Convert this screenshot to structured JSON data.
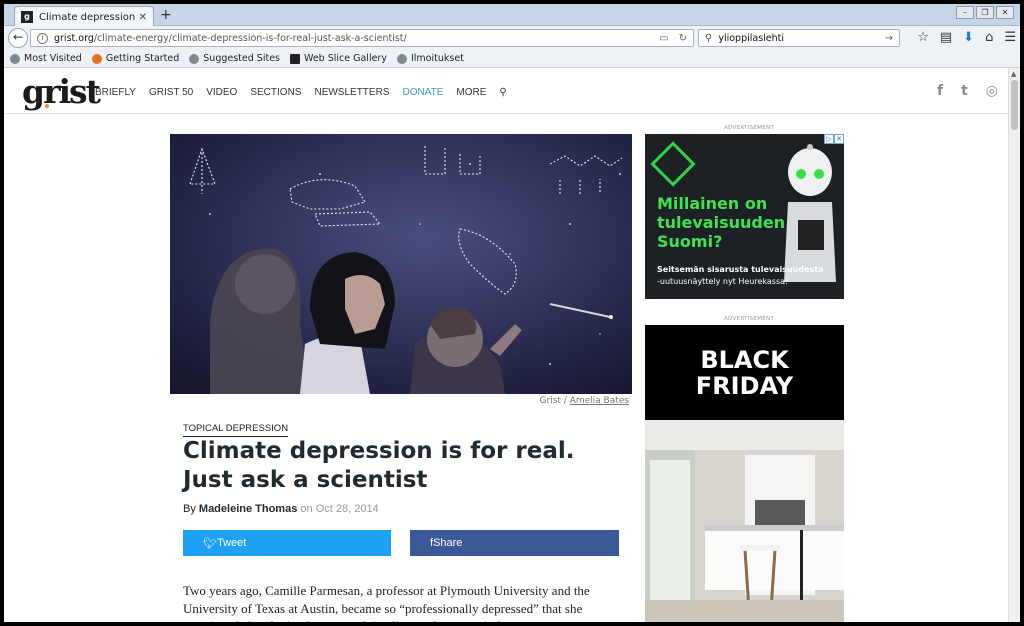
{
  "browser": {
    "tab_title": "Climate depression is for r...",
    "tab_favicon": "g",
    "tab_close": "✕",
    "new_tab": "+",
    "url_domain": "grist.org",
    "url_path": "/climate-energy/climate-depression-is-for-real-just-ask-a-scientist/",
    "search_query": "ylioppilaslehti",
    "bookmarks": [
      "Most Visited",
      "Getting Started",
      "Suggested Sites",
      "Web Slice Gallery",
      "Ilmoitukset"
    ]
  },
  "site": {
    "logo": "grist",
    "nav": [
      "BRIEFLY",
      "GRIST 50",
      "VIDEO",
      "SECTIONS",
      "NEWSLETTERS",
      "DONATE",
      "MORE"
    ],
    "social": [
      "f",
      "t",
      "◎"
    ]
  },
  "article": {
    "credit_prefix": "Grist / ",
    "credit_name": "Amelia Bates",
    "kicker": "TOPICAL DEPRESSION",
    "headline": "Climate depression is for real. Just ask a scientist",
    "by_label": "By ",
    "author": "Madeleine Thomas",
    "date_prefix": " on ",
    "date": "Oct 28, 2014",
    "tweet_label": " Tweet",
    "share_label": " Share",
    "body": "Two years ago, Camille Parmesan, a professor at Plymouth University and the University of Texas at Austin, became so “professionally depressed” that she questioned abandoning her research in climate change entirely."
  },
  "ads": {
    "label": "ADVERTISEMENT",
    "ad1_headline": "Millainen on tulevaisuuden Suomi?",
    "ad1_sub1": "Seitsemän sisarusta tulevaisuudesta",
    "ad1_sub2": "-uutuusnäyttely nyt Heurekassa!",
    "ad2_title": "BLACK FRIDAY"
  },
  "colors": {
    "tweet": "#1da1f2",
    "share": "#3b5998",
    "donate": "#3a9ad9",
    "ad_green": "#3ee34f"
  }
}
